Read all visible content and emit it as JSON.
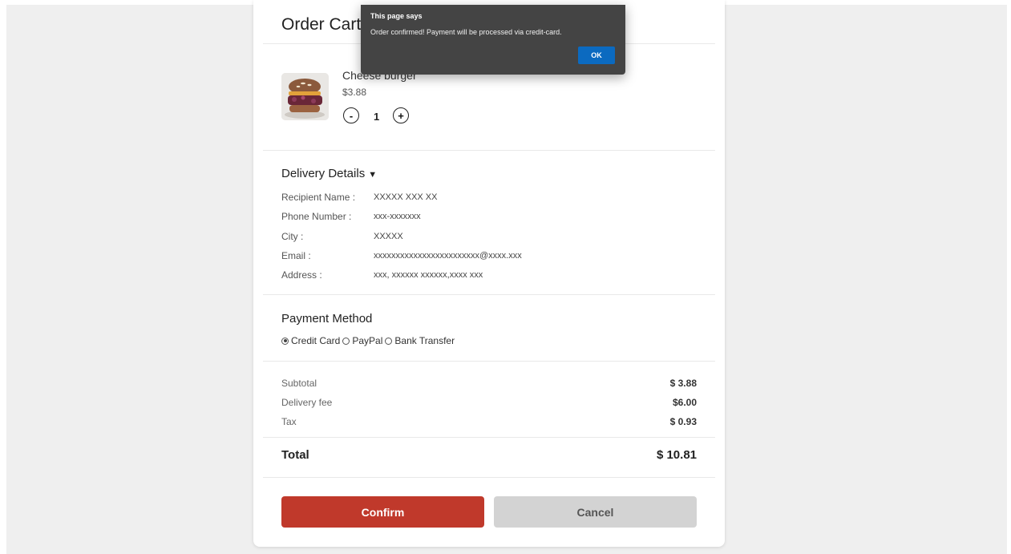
{
  "cart": {
    "title": "Order Cart",
    "item": {
      "name": "Cheese burger",
      "price": "$3.88",
      "quantity": "1",
      "minus": "-",
      "plus": "+"
    }
  },
  "delivery": {
    "title": "Delivery Details",
    "arrow": "▼",
    "rows": [
      {
        "label": "Recipient Name :",
        "value": "XXXXX XXX XX"
      },
      {
        "label": "Phone Number :",
        "value": "xxx-xxxxxxx"
      },
      {
        "label": "City :",
        "value": "XXXXX"
      },
      {
        "label": "Email :",
        "value": "xxxxxxxxxxxxxxxxxxxxxxxx@xxxx.xxx"
      },
      {
        "label": "Address :",
        "value": "xxx, xxxxxx xxxxxx,xxxx xxx"
      }
    ]
  },
  "payment": {
    "title": "Payment Method",
    "options": [
      "Credit Card",
      "PayPal",
      "Bank Transfer"
    ],
    "selected": "Credit Card"
  },
  "summary": {
    "subtotal_label": "Subtotal",
    "subtotal_value": "$ 3.88",
    "delivery_label": "Delivery fee",
    "delivery_value": "$6.00",
    "tax_label": "Tax",
    "tax_value": "$ 0.93",
    "total_label": "Total",
    "total_value": "$ 10.81"
  },
  "actions": {
    "confirm": "Confirm",
    "cancel": "Cancel"
  },
  "dialog": {
    "title": "This page says",
    "message": "Order confirmed! Payment will be processed via credit-card.",
    "ok": "OK"
  },
  "colors": {
    "confirm": "#c0392b",
    "cancel": "#d3d3d3",
    "dialog_bg": "#444444",
    "ok_button": "#0b6ac0"
  }
}
